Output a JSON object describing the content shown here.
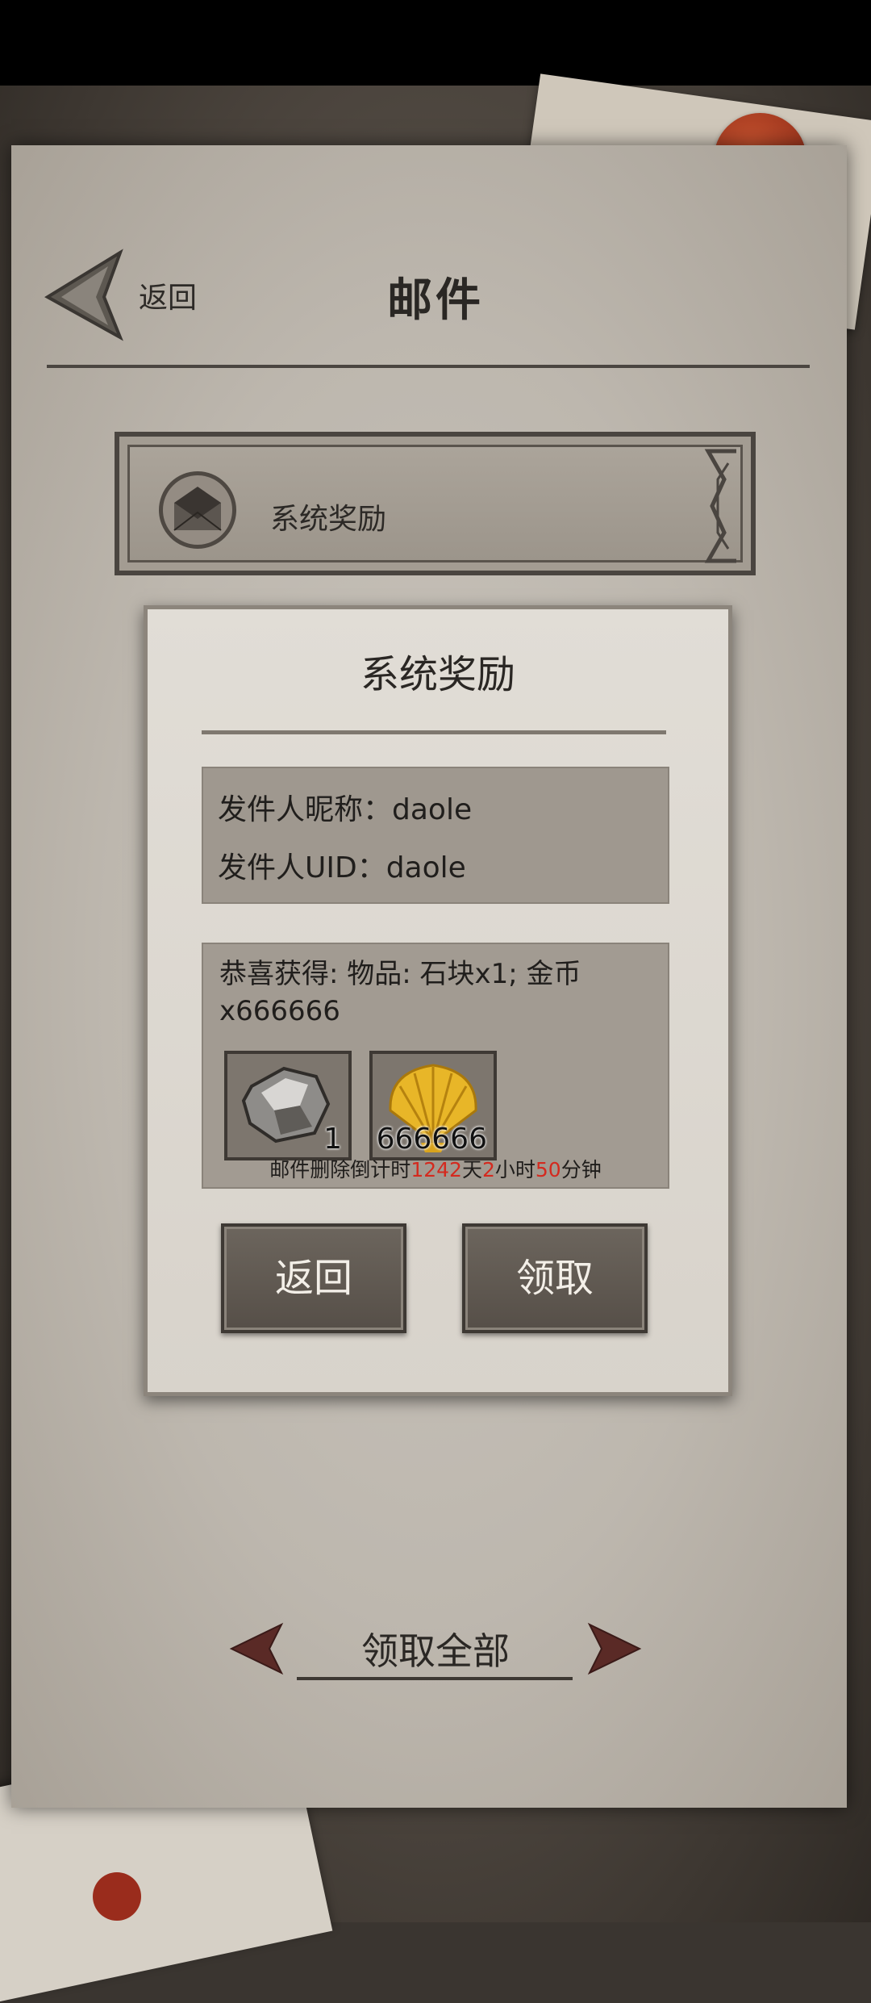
{
  "header": {
    "back_label": "返回",
    "title": "邮件"
  },
  "mail_list": [
    {
      "label": "系统奖励",
      "icon": "envelope-icon"
    }
  ],
  "dialog": {
    "title": "系统奖励",
    "sender_nickname_line": "发件人昵称：daole",
    "sender_uid_line": "发件人UID：daole",
    "reward_text": "恭喜获得: 物品: 石块x1; 金币x666666",
    "items": [
      {
        "name": "stone-icon",
        "count": "1"
      },
      {
        "name": "gold-shell-icon",
        "count": "666666"
      }
    ],
    "countdown": {
      "prefix": "邮件删除倒计时",
      "days": "1242",
      "days_unit": "天",
      "hours": "2",
      "hours_unit": "小时",
      "minutes": "50",
      "minutes_unit": "分钟"
    },
    "back_button": "返回",
    "claim_button": "领取"
  },
  "footer": {
    "collect_all": "领取全部"
  },
  "colors": {
    "accent_red": "#d42a1f",
    "button": "#5f5851",
    "paper": "#c2bcb3"
  }
}
